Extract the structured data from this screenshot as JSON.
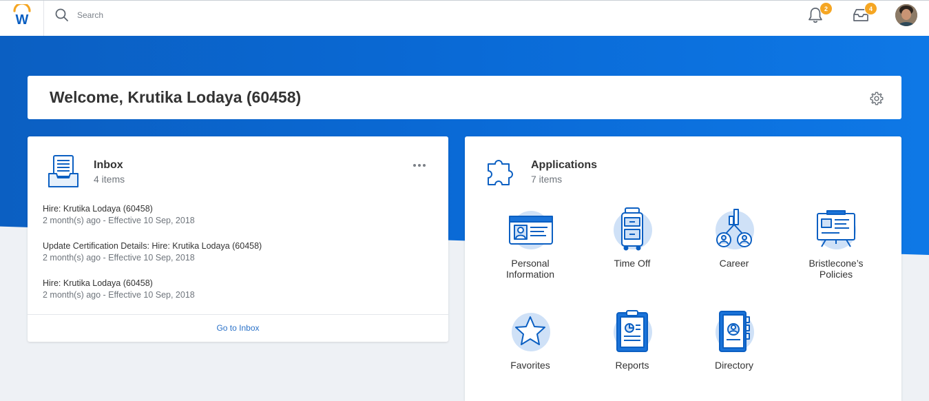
{
  "header": {
    "logo_letter": "W",
    "search_placeholder": "Search",
    "notifications_count": "2",
    "inbox_count": "4"
  },
  "welcome": {
    "title": "Welcome, Krutika Lodaya (60458)"
  },
  "inbox": {
    "title": "Inbox",
    "subtitle": "4 items",
    "tasks": [
      {
        "title": "Hire: Krutika Lodaya (60458)",
        "meta": "2 month(s) ago - Effective 10 Sep, 2018"
      },
      {
        "title": "Update Certification Details: Hire: Krutika Lodaya (60458)",
        "meta": "2 month(s) ago - Effective 10 Sep, 2018"
      },
      {
        "title": "Hire: Krutika Lodaya (60458)",
        "meta": "2 month(s) ago - Effective 10 Sep, 2018"
      }
    ],
    "footer_link": "Go to Inbox"
  },
  "applications": {
    "title": "Applications",
    "subtitle": "7 items",
    "items": [
      {
        "label_line1": "Personal",
        "label_line2": "Information",
        "icon": "id-card-icon"
      },
      {
        "label_line1": "Time Off",
        "label_line2": "",
        "icon": "suitcase-icon"
      },
      {
        "label_line1": "Career",
        "label_line2": "",
        "icon": "career-ladder-icon"
      },
      {
        "label_line1": "Bristlecone’s",
        "label_line2": "Policies",
        "icon": "presentation-board-icon"
      },
      {
        "label_line1": "Favorites",
        "label_line2": "",
        "icon": "star-icon"
      },
      {
        "label_line1": "Reports",
        "label_line2": "",
        "icon": "clipboard-chart-icon"
      },
      {
        "label_line1": "Directory",
        "label_line2": "",
        "icon": "address-book-icon"
      }
    ]
  },
  "colors": {
    "brand_blue": "#0a6ad6",
    "badge_orange": "#f5a623",
    "icon_blue": "#0b5fc2",
    "icon_circle": "#cfe1f7"
  }
}
